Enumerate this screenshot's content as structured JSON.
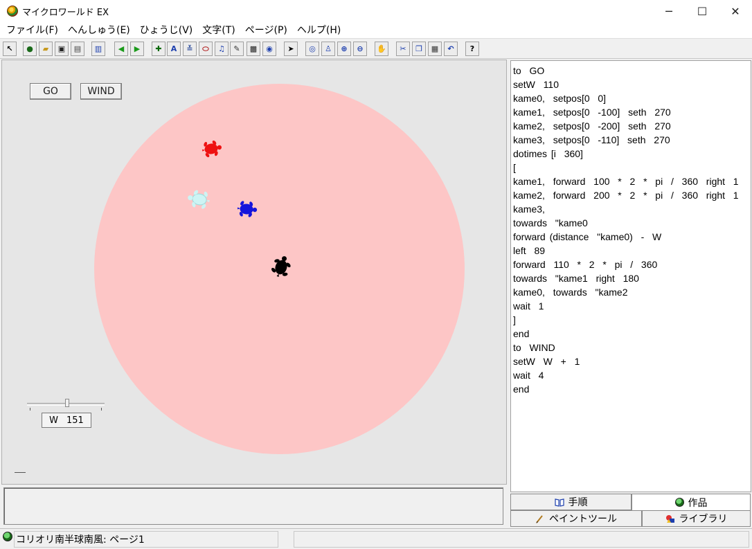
{
  "window": {
    "title": "マイクロワールド EX",
    "minimize": "─",
    "maximize": "☐",
    "close": "✕"
  },
  "menu": [
    "ファイル(F)",
    "へんしゅう(E)",
    "ひょうじ(V)",
    "文字(T)",
    "ページ(P)",
    "ヘルプ(H)"
  ],
  "toolbar": [
    {
      "name": "pointer-small-icon",
      "glyph": "↖",
      "color": "#000"
    },
    {
      "name": "new-project-icon",
      "glyph": "●",
      "color": "#1a6a1a"
    },
    {
      "name": "open-folder-icon",
      "glyph": "▰",
      "color": "#c79a20"
    },
    {
      "name": "save-icon",
      "glyph": "▣",
      "color": "#222"
    },
    {
      "name": "print-icon",
      "glyph": "▤",
      "color": "#444"
    },
    {
      "name": "page-view-icon",
      "glyph": "▥",
      "color": "#1d3fae"
    },
    {
      "name": "arrow-left-icon",
      "glyph": "◀",
      "color": "#1a9a1a"
    },
    {
      "name": "arrow-right-icon",
      "glyph": "▶",
      "color": "#1a9a1a"
    },
    {
      "name": "new-turtle-icon",
      "glyph": "✚",
      "color": "#0a6a0a"
    },
    {
      "name": "text-box-icon",
      "glyph": "A",
      "color": "#1d3fae"
    },
    {
      "name": "slider-tool-icon",
      "glyph": "≚",
      "color": "#2a4a9a"
    },
    {
      "name": "button-tool-icon",
      "glyph": "⬭",
      "color": "#b01818"
    },
    {
      "name": "music-icon",
      "glyph": "♫",
      "color": "#1d3fae"
    },
    {
      "name": "paint-icon",
      "glyph": "✎",
      "color": "#333"
    },
    {
      "name": "video-icon",
      "glyph": "▩",
      "color": "#222"
    },
    {
      "name": "globe-icon",
      "glyph": "◉",
      "color": "#1d3fae"
    },
    {
      "name": "select-arrow-icon",
      "glyph": "➤",
      "color": "#000"
    },
    {
      "name": "eye-icon",
      "glyph": "◎",
      "color": "#1d3fae"
    },
    {
      "name": "stamp-icon",
      "glyph": "♙",
      "color": "#1d3fae"
    },
    {
      "name": "zoom-in-icon",
      "glyph": "⊕",
      "color": "#1d3fae"
    },
    {
      "name": "zoom-out-icon",
      "glyph": "⊖",
      "color": "#1d3fae"
    },
    {
      "name": "stop-hand-icon",
      "glyph": "✋",
      "color": "#c01010"
    },
    {
      "name": "cut-icon",
      "glyph": "✂",
      "color": "#1d3fae"
    },
    {
      "name": "copy-icon",
      "glyph": "❐",
      "color": "#1d3fae"
    },
    {
      "name": "paste-icon",
      "glyph": "▦",
      "color": "#333"
    },
    {
      "name": "undo-icon",
      "glyph": "↶",
      "color": "#1d3fae"
    },
    {
      "name": "help-icon",
      "glyph": "?",
      "color": "#000"
    }
  ],
  "buttons": {
    "go": "GO",
    "wind": "WIND"
  },
  "slider": {
    "label": "W",
    "value": "151"
  },
  "code_lines": [
    "to  GO",
    "setW  110",
    "kame0,  setpos[0  0]",
    "kame1,  setpos[0  -100]  seth  270",
    "kame2,  setpos[0  -200]  seth  270",
    "kame3,  setpos[0  -110]  seth  270",
    "dotimes [i  360]",
    "[",
    "kame1,  forward  100  *  2  *  pi  /  360  right  1",
    "kame2,  forward  200  *  2  *  pi  /  360  right  1",
    "kame3,",
    "towards  \"kame0",
    "forward (distance  \"kame0)  -  W",
    "left  89",
    "forward  110  *  2  *  pi  /  360",
    "towards  \"kame1  right  180",
    "kame0,  towards  \"kame2",
    "wait  1",
    "]",
    "end",
    "to  WIND",
    "setW  W  +  1",
    "wait  4",
    "end"
  ],
  "tabs": {
    "procedures": "手順",
    "project": "作品",
    "paint": "ペイントツール",
    "library": "ライブラリ"
  },
  "status": {
    "text": "コリオリ南半球南風: ページ1"
  },
  "colors": {
    "circle": "#fdc6c6",
    "turtle_red": "#ee1111",
    "turtle_cyan": "#cdf4f4",
    "turtle_blue": "#1414dc",
    "turtle_black": "#000000"
  }
}
